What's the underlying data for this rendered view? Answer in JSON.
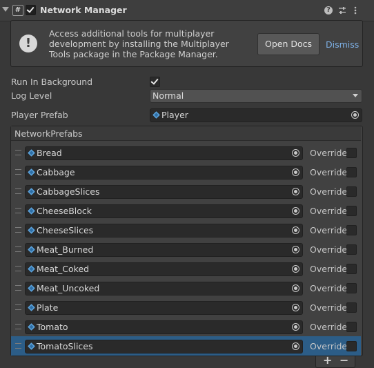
{
  "component": {
    "title": "Network Manager",
    "script_icon_glyph": "#",
    "enabled": true,
    "icons": [
      "help-icon",
      "presets-icon",
      "kebab-menu-icon"
    ]
  },
  "helpbox": {
    "text": "Access additional tools for multiplayer development by installing the Multiplayer Tools package in the Package Manager.",
    "open_docs_label": "Open Docs",
    "dismiss_label": "Dismiss"
  },
  "fields": {
    "run_in_background": {
      "label": "Run In Background",
      "checked": true
    },
    "log_level": {
      "label": "Log Level",
      "value": "Normal"
    },
    "player_prefab": {
      "label": "Player Prefab",
      "value": "Player"
    }
  },
  "network_prefabs": {
    "header": "NetworkPrefabs",
    "override_label": "Override",
    "items": [
      "Bread",
      "Cabbage",
      "CabbageSlices",
      "CheeseBlock",
      "CheeseSlices",
      "Meat_Burned",
      "Meat_Coked",
      "Meat_Uncoked",
      "Plate",
      "Tomato",
      "TomatoSlices"
    ],
    "selected_item": "TomatoSlices",
    "add_label": "+",
    "remove_label": "−"
  },
  "colors": {
    "background": "#383838",
    "selection": "#2c5d87",
    "link": "#7fb3ea",
    "prefab_icon": "#5aa0d8"
  }
}
